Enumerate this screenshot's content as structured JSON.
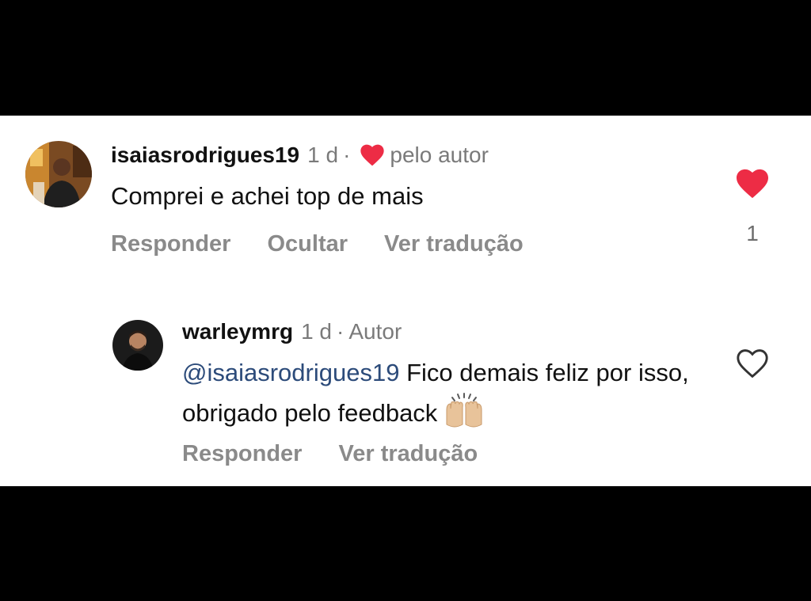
{
  "comments": [
    {
      "username": "isaiasrodrigues19",
      "time": "1 d",
      "separator": "·",
      "badge": "pelo autor",
      "badge_icon": "heart-icon",
      "text": "Comprei e achei top de mais",
      "actions": [
        "Responder",
        "Ocultar",
        "Ver tradução"
      ],
      "likes": "1",
      "liked": true
    },
    {
      "username": "warleymrg",
      "time": "1 d",
      "separator": "·",
      "badge": "Autor",
      "mention": "@isaiasrodrigues19",
      "text": " Fico demais feliz por isso, obrigado pelo feedback",
      "emoji": "raising-hands-emoji",
      "actions": [
        "Responder",
        "Ver tradução"
      ],
      "liked": false
    }
  ],
  "colors": {
    "like_red": "#ed2c45",
    "mention_blue": "#2c4b7a",
    "muted_text": "#7a7a7a"
  }
}
